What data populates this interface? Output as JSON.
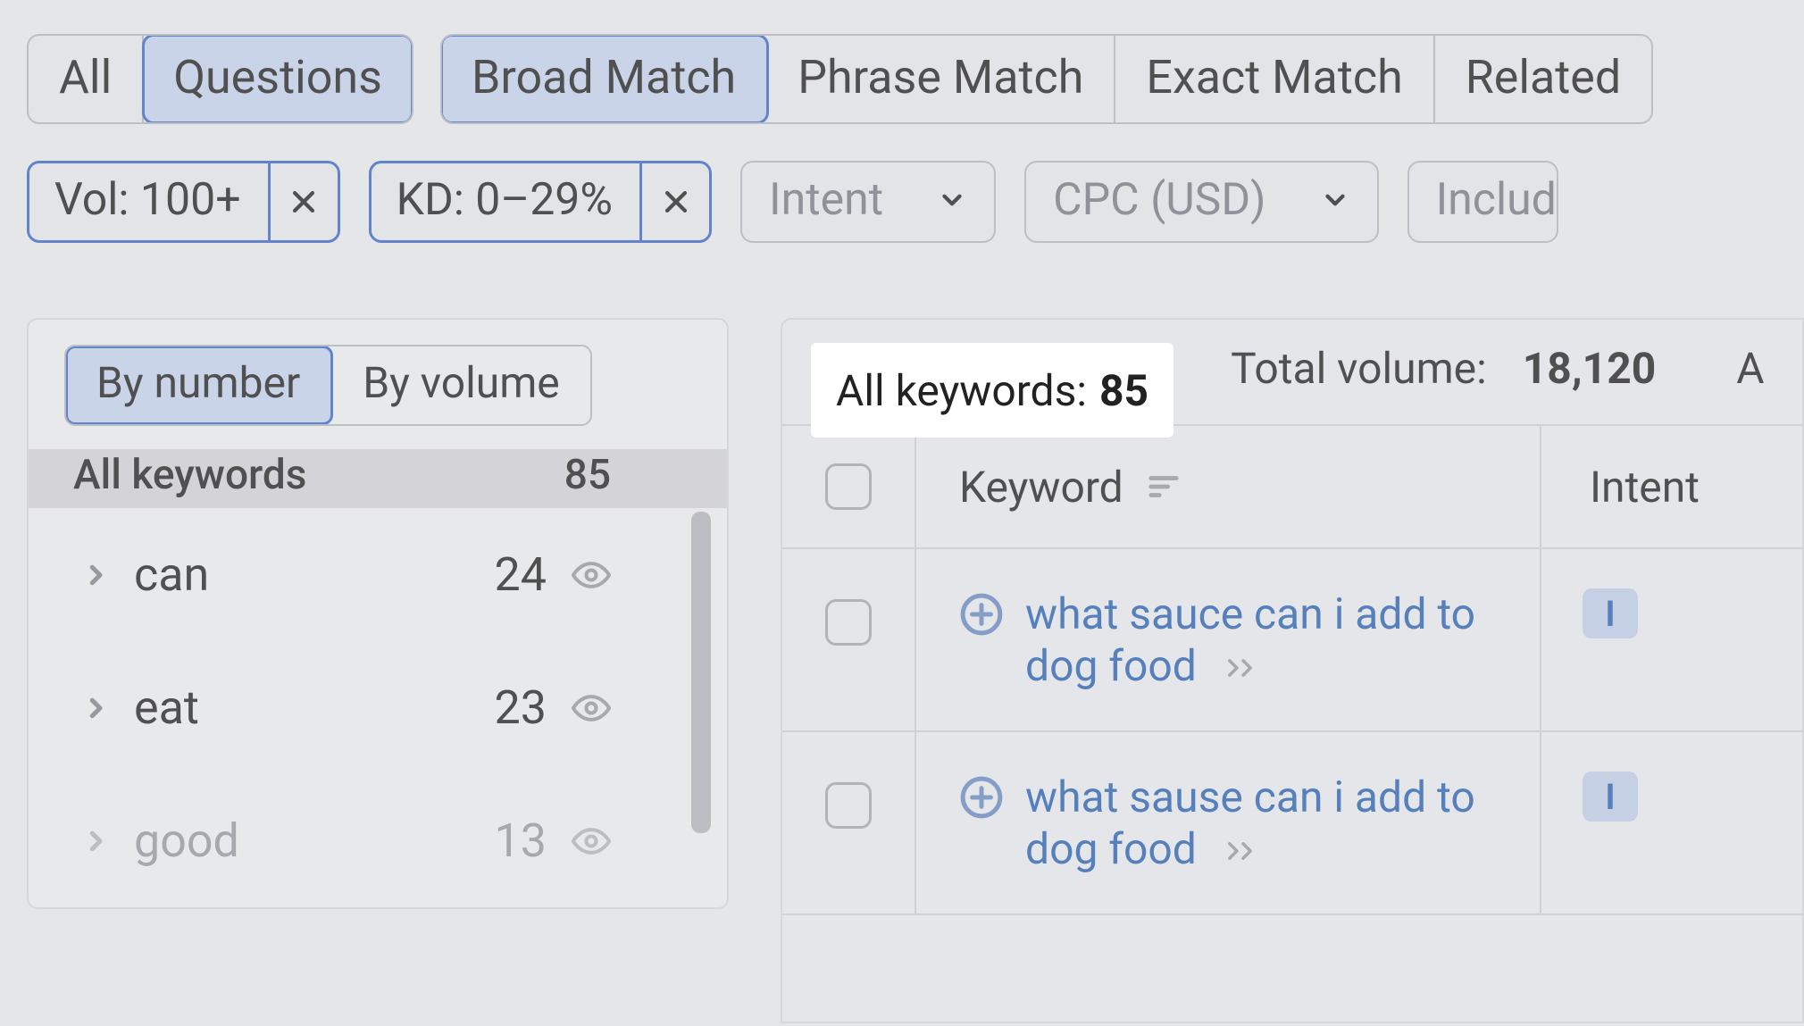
{
  "tabs": {
    "group1": [
      "All",
      "Questions"
    ],
    "group2": [
      "Broad Match",
      "Phrase Match",
      "Exact Match",
      "Related"
    ],
    "active": [
      "Questions",
      "Broad Match"
    ]
  },
  "filters": {
    "chips": [
      {
        "label": "Vol: 100+"
      },
      {
        "label": "KD: 0–29%"
      }
    ],
    "drops": [
      {
        "label": "Intent"
      },
      {
        "label": "CPC (USD)"
      },
      {
        "label": "Includ"
      }
    ]
  },
  "sidebar": {
    "sort_tabs": {
      "by_number": "By number",
      "by_volume": "By volume",
      "active": "By number"
    },
    "header": {
      "label": "All keywords",
      "count": "85"
    },
    "groups": [
      {
        "name": "can",
        "count": "24",
        "muted": false
      },
      {
        "name": "eat",
        "count": "23",
        "muted": false
      },
      {
        "name": "good",
        "count": "13",
        "muted": true
      }
    ]
  },
  "stats": {
    "all_label": "All keywords:",
    "all_value": "85",
    "total_label": "Total volume:",
    "total_value": "18,120",
    "trail": "A"
  },
  "table": {
    "headers": {
      "keyword": "Keyword",
      "intent": "Intent"
    },
    "rows": [
      {
        "keyword": "what sauce can i add to dog food",
        "intent": "I"
      },
      {
        "keyword": "what sause can i add to dog food",
        "intent": "I"
      }
    ]
  }
}
